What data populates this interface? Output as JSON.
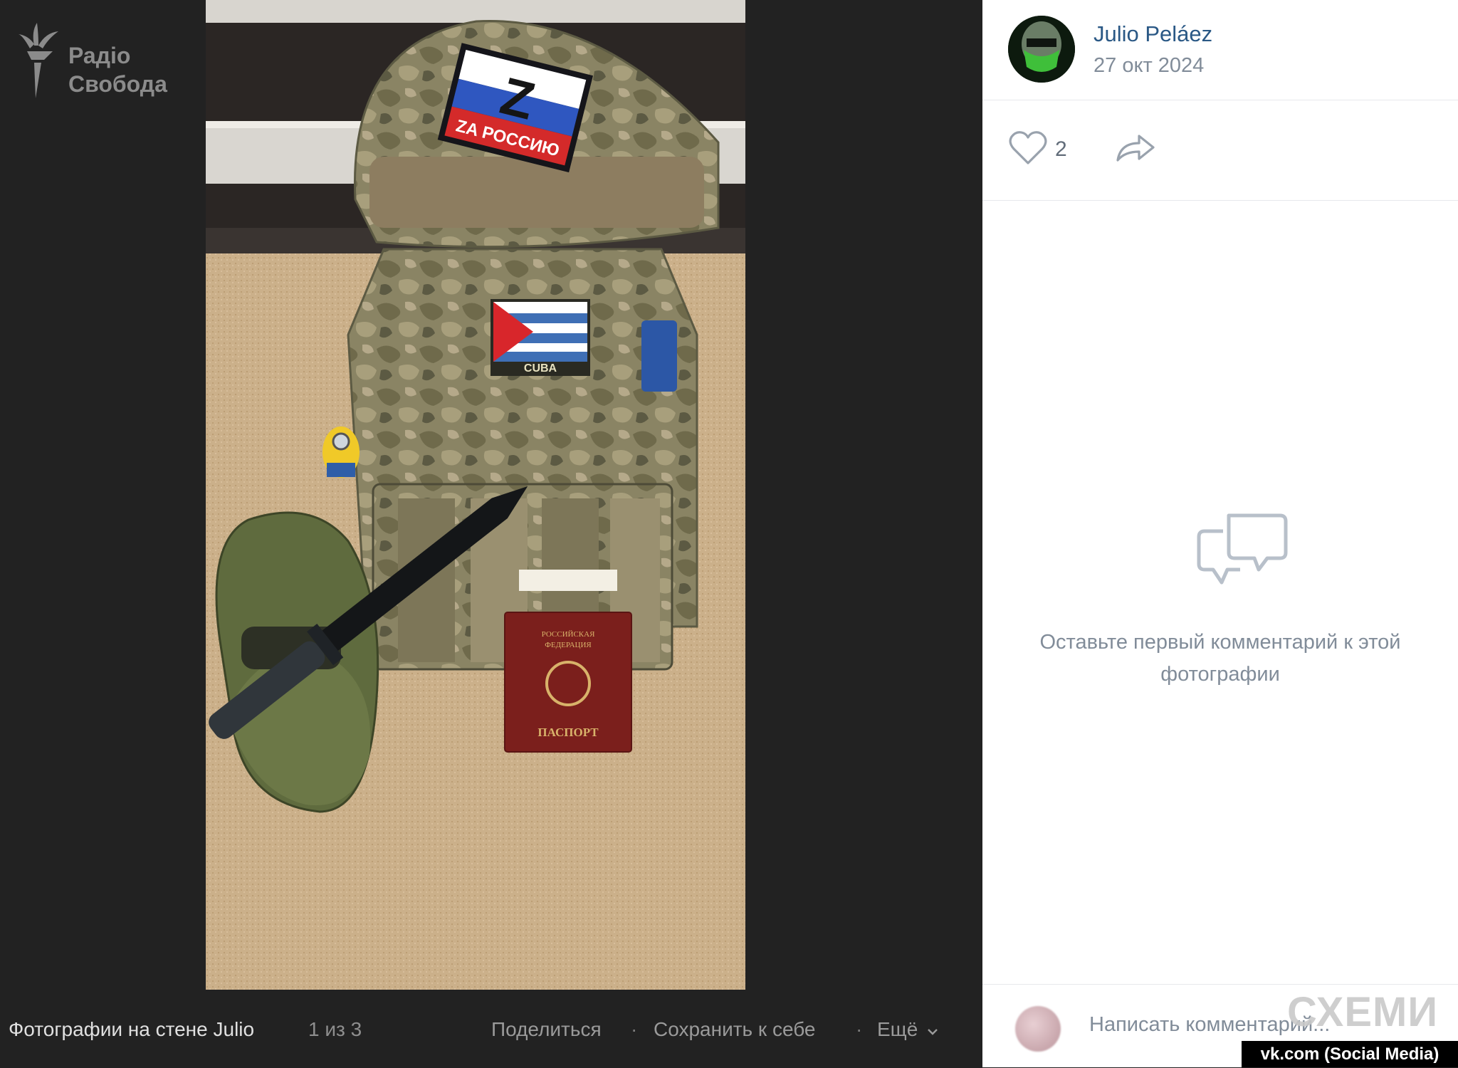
{
  "watermark": {
    "line1": "Радіо",
    "line2": "Свобода"
  },
  "photo": {
    "patch_z_letter": "Z",
    "patch_z_text": "ZA РОССИЮ",
    "patch_cuba_text": "CUBA",
    "passport_line1": "РОССИЙСКАЯ",
    "passport_line2": "ФЕДЕРАЦИЯ",
    "passport_title": "ПАСПОРТ"
  },
  "bottom_bar": {
    "title": "Фотографии на стене Julio",
    "counter": "1 из 3",
    "share": "Поделиться",
    "save": "Сохранить к себе",
    "more": "Ещё",
    "separator": "·"
  },
  "author": {
    "name": "Julio Peláez",
    "date": "27 окт 2024"
  },
  "actions": {
    "likes": "2"
  },
  "comments": {
    "empty_text": "Оставьте первый комментарий к этой фотографии"
  },
  "composer": {
    "placeholder": "Написать комментарий..."
  },
  "overlay": {
    "logo": "СХЕМИ",
    "credit": "vk.com (Social Media)"
  },
  "colors": {
    "link": "#2a5885",
    "muted": "#818c99",
    "viewer_bg": "#222222"
  }
}
